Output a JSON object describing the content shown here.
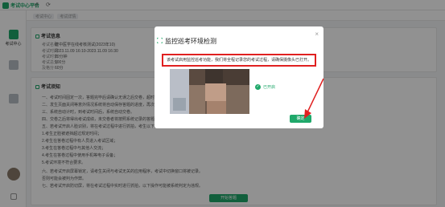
{
  "app": {
    "logo_text": "考试中心平台",
    "window_controls": [
      "↺",
      "⟳"
    ]
  },
  "breadcrumb": {
    "items": [
      "考试中心",
      "考试详情"
    ]
  },
  "sidebar": {
    "items": [
      {
        "label": "考试中心",
        "icon": "exam-icon"
      },
      {
        "label": "",
        "icon": "list-icon"
      },
      {
        "label": "",
        "icon": "book-icon"
      },
      {
        "label": "",
        "icon": "avatar"
      },
      {
        "label": "",
        "icon": "logout-icon"
      }
    ]
  },
  "exam_info": {
    "title": "考试信息",
    "rows": [
      {
        "label": "考试名称",
        "value": "建中医学在线考核测试(2023年10)"
      },
      {
        "label": "考试时间",
        "value": "2023.11.09 16:10-2023.11.09 16:30"
      },
      {
        "label": "考试时长",
        "value": "20分钟"
      },
      {
        "label": "考试总分",
        "value": "100分"
      },
      {
        "label": "及格分",
        "value": "60分"
      }
    ]
  },
  "exam_notice": {
    "title": "考试须知",
    "lines": [
      "一、考试时间固定一次，答题完毕后请确认无误之后交卷，超时系统将自动交卷。",
      "二、发生页面关闭等意外情况系统将自动保存答题的进度，再次进入考试可继续作答。",
      "三、系统自动计时，到考试时间后，系统自动交卷。",
      "四、交卷之后将得出考试成绩，未交卷者将按照系统记录的答题结果自动交卷。",
      "五、若考试开启人脸识别，将在考试过程中进行抓拍，考生以下情况将被判定为作弊：",
      "1.考生正脸被遮挡超过规定时间；",
      "2.考生在答卷过程中有人员进入考试区域；",
      "3.考生在答卷过程中与其他人交流；",
      "4.考生在答卷过程中使用手机等电子设备；",
      "5.考试环境不符合要求。",
      "六、若考试开启屏幕锁定，请考生关闭与考试无关的应用程序，考试中切换窗口将被记录。",
      "否则可能会被判为作弊。",
      "七、若考试开启防切屏，将在考试过程中实时进行抓拍，以下操作可能被系统判定为违规。"
    ],
    "start_button": "开始答题"
  },
  "modal": {
    "title": "监控巡考环境检测",
    "close": "×",
    "notice": "该考试启用监控巡考功能，我们将全程记录您的考试过程，请确保摄像头已打开。",
    "camera_status": "已开启",
    "confirm_button": "确定"
  },
  "colors": {
    "brand": "#1fa86a",
    "highlight": "#e02020"
  }
}
